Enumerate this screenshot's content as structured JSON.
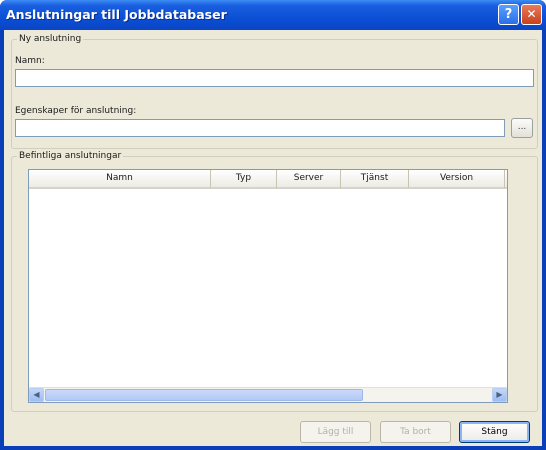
{
  "window": {
    "title": "Anslutningar till Jobbdatabaser",
    "help_glyph": "?",
    "close_glyph": "✕"
  },
  "new_connection": {
    "legend": "Ny anslutning",
    "name_label": "Namn:",
    "name_value": "",
    "properties_label": "Egenskaper för anslutning:",
    "properties_value": "",
    "browse_label": "..."
  },
  "existing": {
    "legend": "Befintliga anslutningar",
    "columns": [
      "Namn",
      "Typ",
      "Server",
      "Tjänst",
      "Version"
    ],
    "rows": []
  },
  "scrollbar": {
    "left_arrow": "◀",
    "right_arrow": "▶"
  },
  "buttons": {
    "add": "Lägg till",
    "remove": "Ta bort",
    "close": "Stäng"
  },
  "icons": {
    "help": "help-icon",
    "close": "close-icon",
    "scroll_left": "scroll-left-arrow-icon",
    "scroll_right": "scroll-right-arrow-icon"
  }
}
